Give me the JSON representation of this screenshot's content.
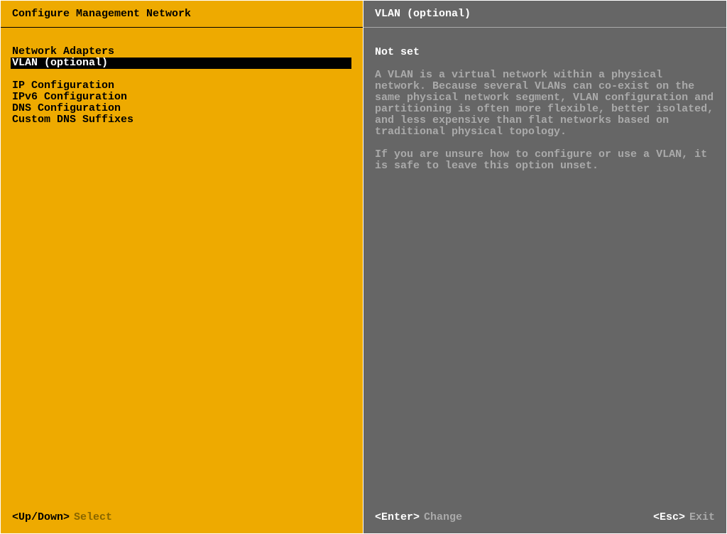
{
  "left": {
    "title": "Configure Management Network",
    "menu_group1": [
      "Network Adapters",
      "VLAN (optional)"
    ],
    "menu_group2": [
      "IP Configuration",
      "IPv6 Configuration",
      "DNS Configuration",
      "Custom DNS Suffixes"
    ],
    "selected_index": 1,
    "footer_key": "<Up/Down>",
    "footer_action": "Select"
  },
  "right": {
    "title": "VLAN (optional)",
    "status": "Not set",
    "description_p1": "A VLAN is a virtual network within a physical network. Because several VLANs can co-exist on the same physical network segment, VLAN configuration and partitioning is often more flexible, better isolated, and less expensive than flat networks based on traditional physical topology.",
    "description_p2": "If you are unsure how to configure or use a VLAN, it is safe to leave this option unset.",
    "footer_left_key": "<Enter>",
    "footer_left_action": "Change",
    "footer_right_key": "<Esc>",
    "footer_right_action": "Exit"
  }
}
